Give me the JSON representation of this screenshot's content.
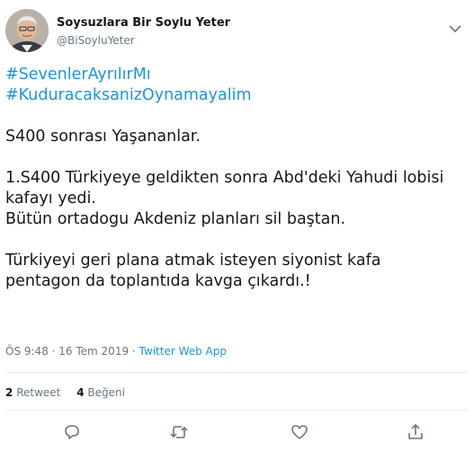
{
  "author": {
    "display_name": "Soysuzlara Bir Soylu Yeter",
    "handle": "@BiSoyluYeter",
    "avatar_icon": "user-avatar-photo"
  },
  "tweet": {
    "hashtags": [
      "#SevenlerAyrılırMı",
      "#KuduracaksanizOynamayalim"
    ],
    "paragraphs": [
      [
        "S400 sonrası Yaşananlar."
      ],
      [
        "1.S400 Türkiyeye geldikten sonra Abd'deki Yahudi lobisi",
        "kafayı yedi.",
        "Bütün ortadogu Akdeniz planları sil baştan."
      ],
      [
        "Türkiyeyi geri plana atmak isteyen siyonist kafa",
        "pentagon da toplantıda kavga çıkardı.!"
      ]
    ]
  },
  "meta": {
    "time": "ÖS 9:48",
    "separator": " · ",
    "date": "16 Tem 2019",
    "source": "Twitter Web App"
  },
  "stats": {
    "retweet_count": "2",
    "retweet_label": "Retweet",
    "like_count": "4",
    "like_label": "Beğeni"
  },
  "actions": {
    "reply_icon": "reply-icon",
    "retweet_icon": "retweet-icon",
    "like_icon": "heart-icon",
    "share_icon": "share-icon"
  },
  "colors": {
    "link": "#1b95e0",
    "text": "#14171a",
    "muted": "#657786",
    "divider": "#e6ecf0"
  }
}
